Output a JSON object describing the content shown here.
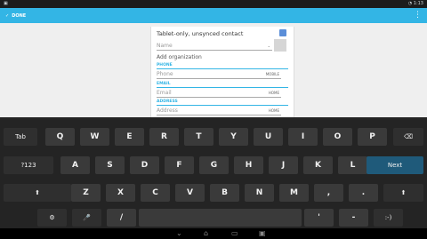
{
  "status": {
    "left": "▣",
    "right": "◔ 1:13"
  },
  "actionbar": {
    "done_label": "DONE",
    "overflow": "⋮"
  },
  "editor": {
    "account": "Tablet-only, unsynced contact",
    "name_placeholder": "Name",
    "add_org": "Add organization",
    "phone_section": "PHONE",
    "phone_placeholder": "Phone",
    "phone_type": "MOBILE",
    "email_section": "EMAIL",
    "email_placeholder": "Email",
    "email_type": "HOME",
    "address_section": "ADDRESS",
    "address_placeholder": "Address",
    "address_type": "HOME"
  },
  "keyboard": {
    "row1": [
      "Tab",
      "Q",
      "W",
      "E",
      "R",
      "T",
      "Y",
      "U",
      "I",
      "O",
      "P",
      "⌫"
    ],
    "row2": [
      "?123",
      "A",
      "S",
      "D",
      "F",
      "G",
      "H",
      "J",
      "K",
      "L",
      "Next"
    ],
    "row3": [
      "⬆",
      "Z",
      "X",
      "C",
      "V",
      "B",
      "N",
      "M",
      ",",
      ".",
      "⬆"
    ],
    "row4": [
      "⚙",
      "🎤",
      "/",
      "",
      "'",
      "-",
      ":-)"
    ]
  },
  "navbar": {
    "back": "⌄",
    "home": "⌂",
    "recent": "▭",
    "screenshot": "▣"
  }
}
